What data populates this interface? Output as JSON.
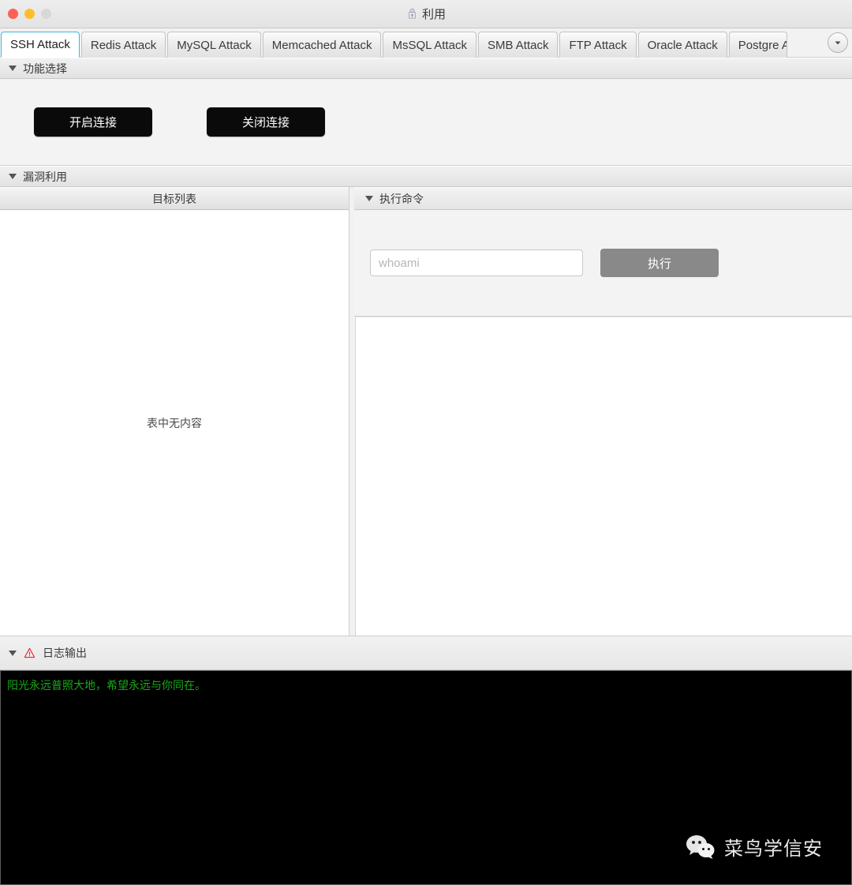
{
  "window": {
    "title": "利用",
    "title_icon": "app-lock-icon",
    "traffic_lights": [
      {
        "name": "close",
        "color": "#ff5f57"
      },
      {
        "name": "minimize",
        "color": "#ffbd2e"
      },
      {
        "name": "zoom",
        "color": "#d8d8d8"
      }
    ]
  },
  "tabs": {
    "items": [
      {
        "label": "SSH Attack",
        "active": true
      },
      {
        "label": "Redis Attack",
        "active": false
      },
      {
        "label": "MySQL Attack",
        "active": false
      },
      {
        "label": "Memcached Attack",
        "active": false
      },
      {
        "label": "MsSQL Attack",
        "active": false
      },
      {
        "label": "SMB Attack",
        "active": false
      },
      {
        "label": "FTP Attack",
        "active": false
      },
      {
        "label": "Oracle Attack",
        "active": false
      },
      {
        "label": "Postgre A",
        "active": false
      }
    ],
    "overflow_icon": "chevron-down-icon"
  },
  "function_section": {
    "header": "功能选择",
    "caret_icon": "caret-down-icon",
    "open_button": "开启连接",
    "close_button": "关闭连接"
  },
  "exploit_section": {
    "header": "漏洞利用",
    "caret_icon": "caret-down-icon",
    "target_list": {
      "column_header": "目标列表",
      "empty_text": "表中无内容"
    },
    "command": {
      "header": "执行命令",
      "caret_icon": "caret-down-icon",
      "input_placeholder": "whoami",
      "input_value": "",
      "execute_button": "执行",
      "output_text": ""
    }
  },
  "log_section": {
    "header": "日志输出",
    "caret_icon": "caret-down-icon",
    "warning_icon": "warning-triangle-icon",
    "lines": [
      "阳光永远普照大地，希望永远与你同在。"
    ],
    "text_color": "#19a919",
    "background": "#000000"
  },
  "watermark": {
    "icon": "wechat-icon",
    "label": "菜鸟学信安"
  }
}
